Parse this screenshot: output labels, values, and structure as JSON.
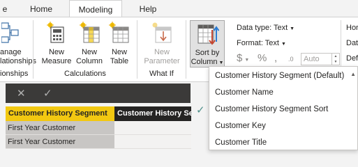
{
  "tabs": [
    {
      "label": "e",
      "active": false
    },
    {
      "label": "Home",
      "active": false
    },
    {
      "label": "Modeling",
      "active": true
    },
    {
      "label": "Help",
      "active": false
    }
  ],
  "ribbon": {
    "relationships": {
      "line1": "anage",
      "line2": "lationships",
      "group": "ionships"
    },
    "new_measure": {
      "line1": "New",
      "line2": "Measure"
    },
    "new_column": {
      "line1": "New",
      "line2": "Column"
    },
    "new_table": {
      "line1": "New",
      "line2": "Table"
    },
    "calculations_group": "Calculations",
    "new_parameter": {
      "line1": "New",
      "line2": "Parameter"
    },
    "whatif_group": "What If",
    "sort_by_column": {
      "line1": "Sort by",
      "line2": "Column"
    },
    "data_type": "Data type: Text",
    "format": "Format: Text",
    "currency_symbol": "$",
    "percent_symbol": "%",
    "comma_symbol": ",",
    "decimal_symbol": ".0",
    "auto_value": "Auto",
    "right_cut": [
      "Hor",
      "Dat",
      "Def"
    ]
  },
  "formula_bar": {
    "cancel": "✕",
    "commit": "✓"
  },
  "table": {
    "columns": [
      "Customer History Segment",
      "Customer History Se"
    ],
    "rows": [
      "First Year Customer",
      "First Year Customer"
    ]
  },
  "sort_dropdown": {
    "items": [
      {
        "label": "Customer History Segment (Default)",
        "checked": false
      },
      {
        "label": "Customer Name",
        "checked": false
      },
      {
        "label": "Customer History Segment Sort",
        "checked": true
      },
      {
        "label": "Customer Key",
        "checked": false
      },
      {
        "label": "Customer Title",
        "checked": false
      }
    ]
  },
  "colors": {
    "accent_yellow": "#f2c811",
    "dark_header": "#252423",
    "check_color": "#4f8f8a"
  }
}
